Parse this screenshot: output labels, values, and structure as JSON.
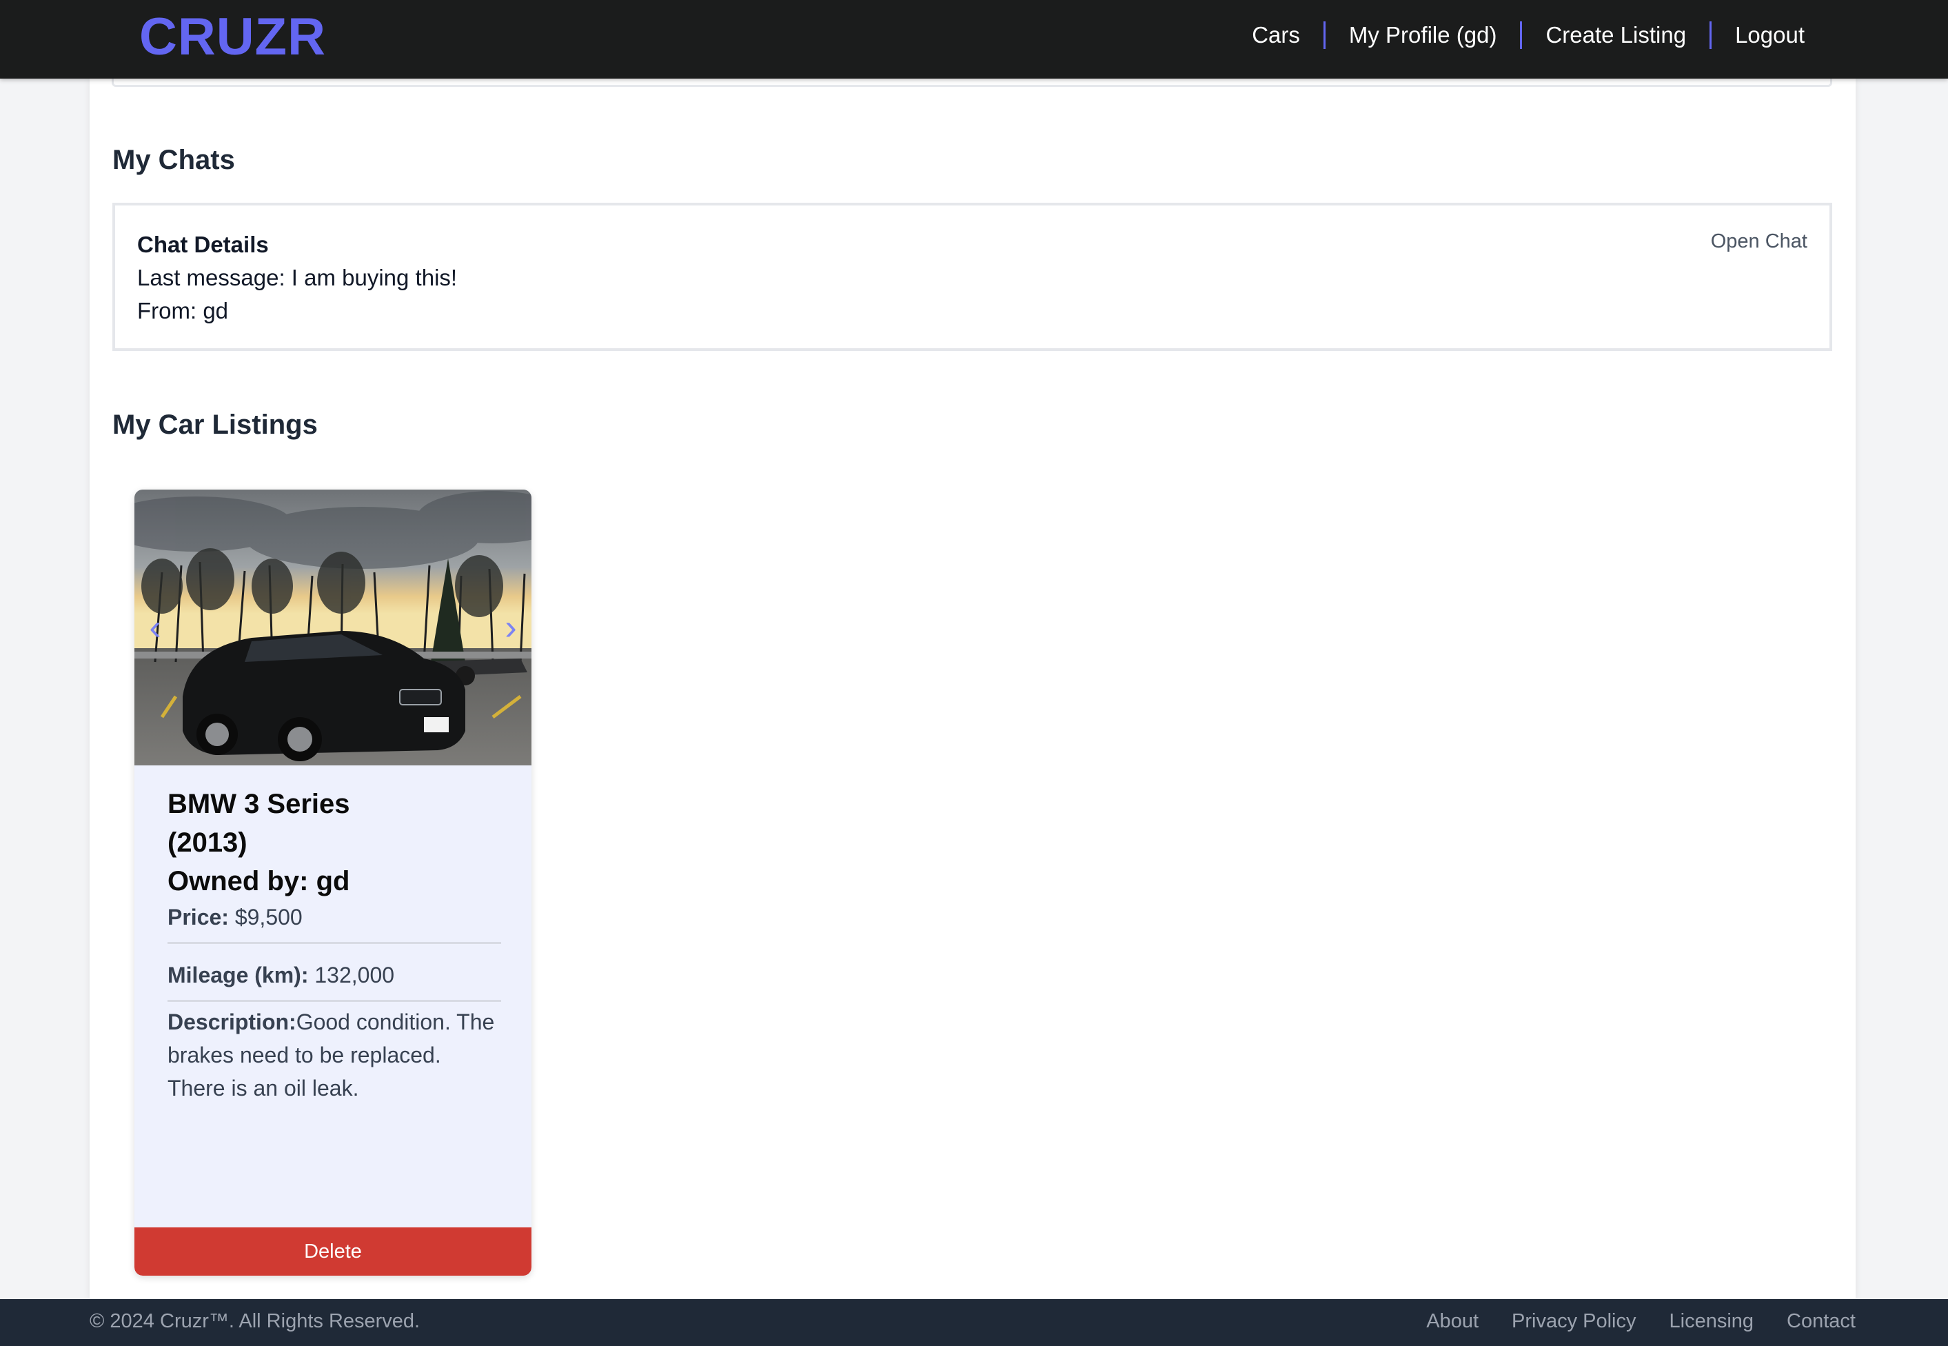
{
  "brand": {
    "logo": "CRUZR",
    "accent_color": "#6366f1"
  },
  "nav": {
    "links": [
      {
        "label": "Cars"
      },
      {
        "label": "My Profile (gd)"
      },
      {
        "label": "Create Listing"
      },
      {
        "label": "Logout"
      }
    ]
  },
  "chats": {
    "heading": "My Chats",
    "items": [
      {
        "title": "Chat Details",
        "last_message": "Last message: I am buying this!",
        "from": "From: gd",
        "action": "Open Chat"
      }
    ]
  },
  "listings": {
    "heading": "My Car Listings",
    "items": [
      {
        "title_line1": "BMW 3 Series",
        "title_line2": "(2013)",
        "title_line3": "Owned by: gd",
        "price_label": "Price:",
        "price_value": "$9,500",
        "mileage_label": "Mileage (km):",
        "mileage_value": "132,000",
        "description_label": "Description:",
        "description_value": "Good condition. The brakes need to be replaced. There is an oil leak.",
        "prev_arrow": "‹",
        "next_arrow": "›",
        "delete_label": "Delete",
        "delete_color": "#d03a32"
      }
    ]
  },
  "footer": {
    "copyright": "© 2024 Cruzr™. All Rights Reserved.",
    "links": [
      {
        "label": "About"
      },
      {
        "label": "Privacy Policy"
      },
      {
        "label": "Licensing"
      },
      {
        "label": "Contact"
      }
    ]
  }
}
